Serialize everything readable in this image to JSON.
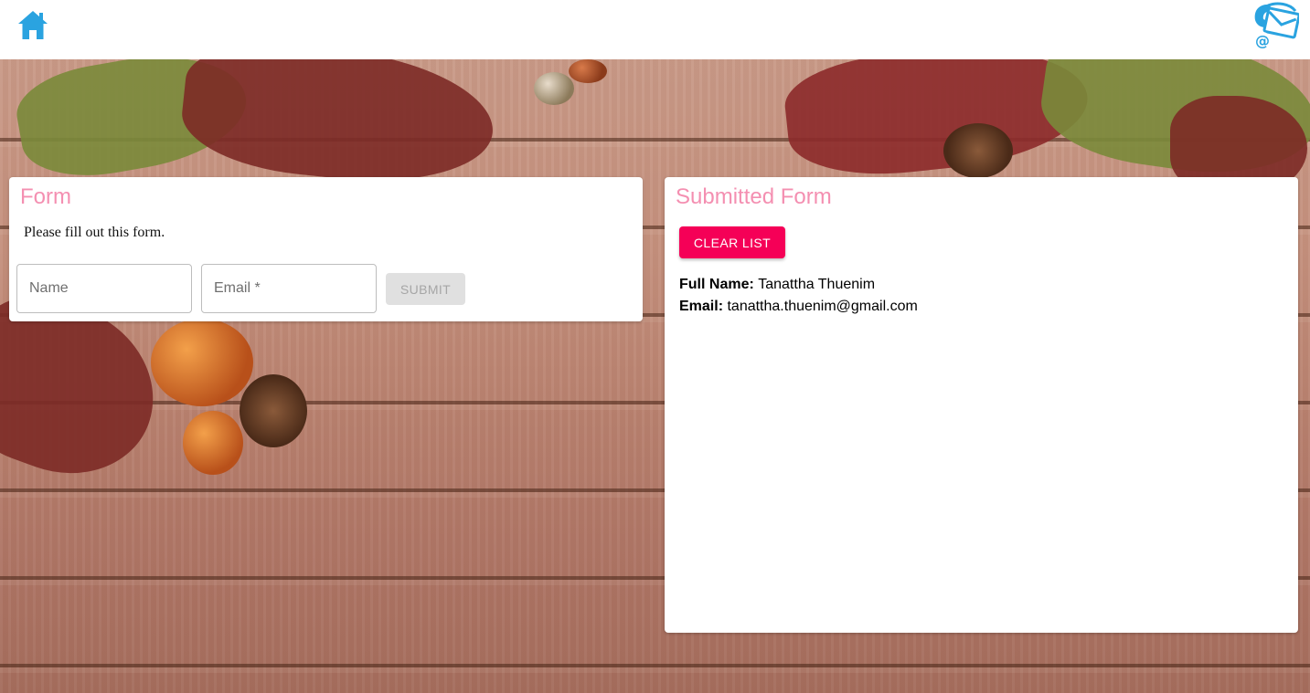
{
  "header": {
    "home_icon": "home-icon",
    "contact_icon": "phone-email-icon",
    "accent_color": "#2aa3e0"
  },
  "form_card": {
    "title": "Form",
    "instructions": "Please fill out this form.",
    "name_placeholder": "Name",
    "email_placeholder": "Email *",
    "name_value": "",
    "email_value": "",
    "submit_label": "SUBMIT",
    "title_color": "#f48fb1"
  },
  "submitted_card": {
    "title": "Submitted Form",
    "clear_label": "CLEAR LIST",
    "clear_color": "#f50057",
    "entries": [
      {
        "full_name_label": "Full Name:",
        "full_name": "Tanattha Thuenim",
        "email_label": "Email:",
        "email": "tanattha.thuenim@gmail.com"
      }
    ]
  }
}
